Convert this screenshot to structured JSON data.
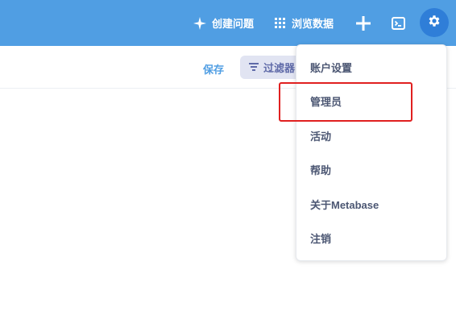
{
  "topbar": {
    "create_label": "创建问题",
    "browse_label": "浏览数据",
    "icons": [
      "sparkle-icon",
      "grid-icon",
      "plus-icon",
      "terminal-icon",
      "gear-icon"
    ]
  },
  "subbar": {
    "save_label": "保存",
    "filter_label": "过滤器"
  },
  "menu": {
    "items": [
      {
        "label": "账户设置"
      },
      {
        "label": "管理员"
      },
      {
        "label": "活动"
      },
      {
        "label": "帮助"
      },
      {
        "label": "关于Metabase"
      },
      {
        "label": "注销"
      }
    ]
  },
  "colors": {
    "topbar": "#509ee3",
    "gear_bg": "#2f7ed8",
    "menu_text": "#4c5773",
    "highlight": "#e02020"
  }
}
